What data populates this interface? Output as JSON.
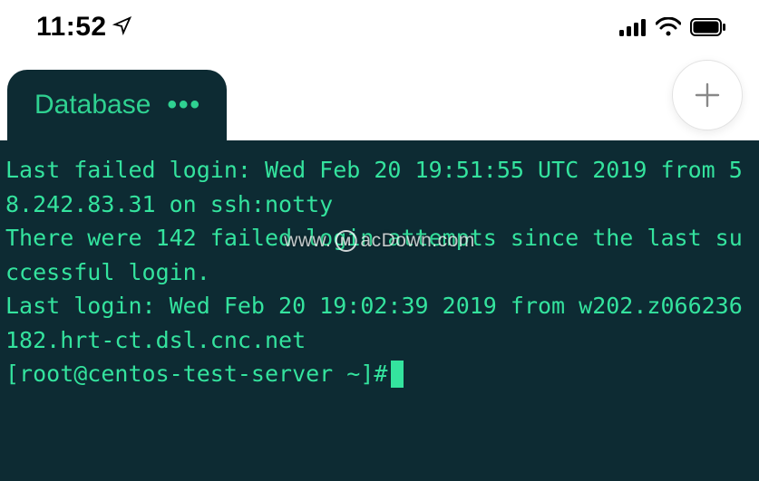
{
  "status_bar": {
    "time": "11:52",
    "location_icon": "location-arrow",
    "cell_bars": 4,
    "wifi": true,
    "battery_level": "full"
  },
  "tabs": {
    "active": {
      "label": "Database",
      "more_glyph": "•••"
    },
    "add_label": "+"
  },
  "terminal": {
    "lines": [
      "Last failed login: Wed Feb 20 19:51:55 UTC 2019 from 58.242.83.31 on ssh:notty",
      "There were 142 failed login attempts since the last successful login.",
      "Last login: Wed Feb 20 19:02:39 2019 from w202.z066236182.hrt-ct.dsl.cnc.net"
    ],
    "prompt": "[root@centos-test-server ~]# "
  },
  "watermark": {
    "prefix": "www.",
    "badge": "M",
    "suffix": "acDown.com"
  }
}
